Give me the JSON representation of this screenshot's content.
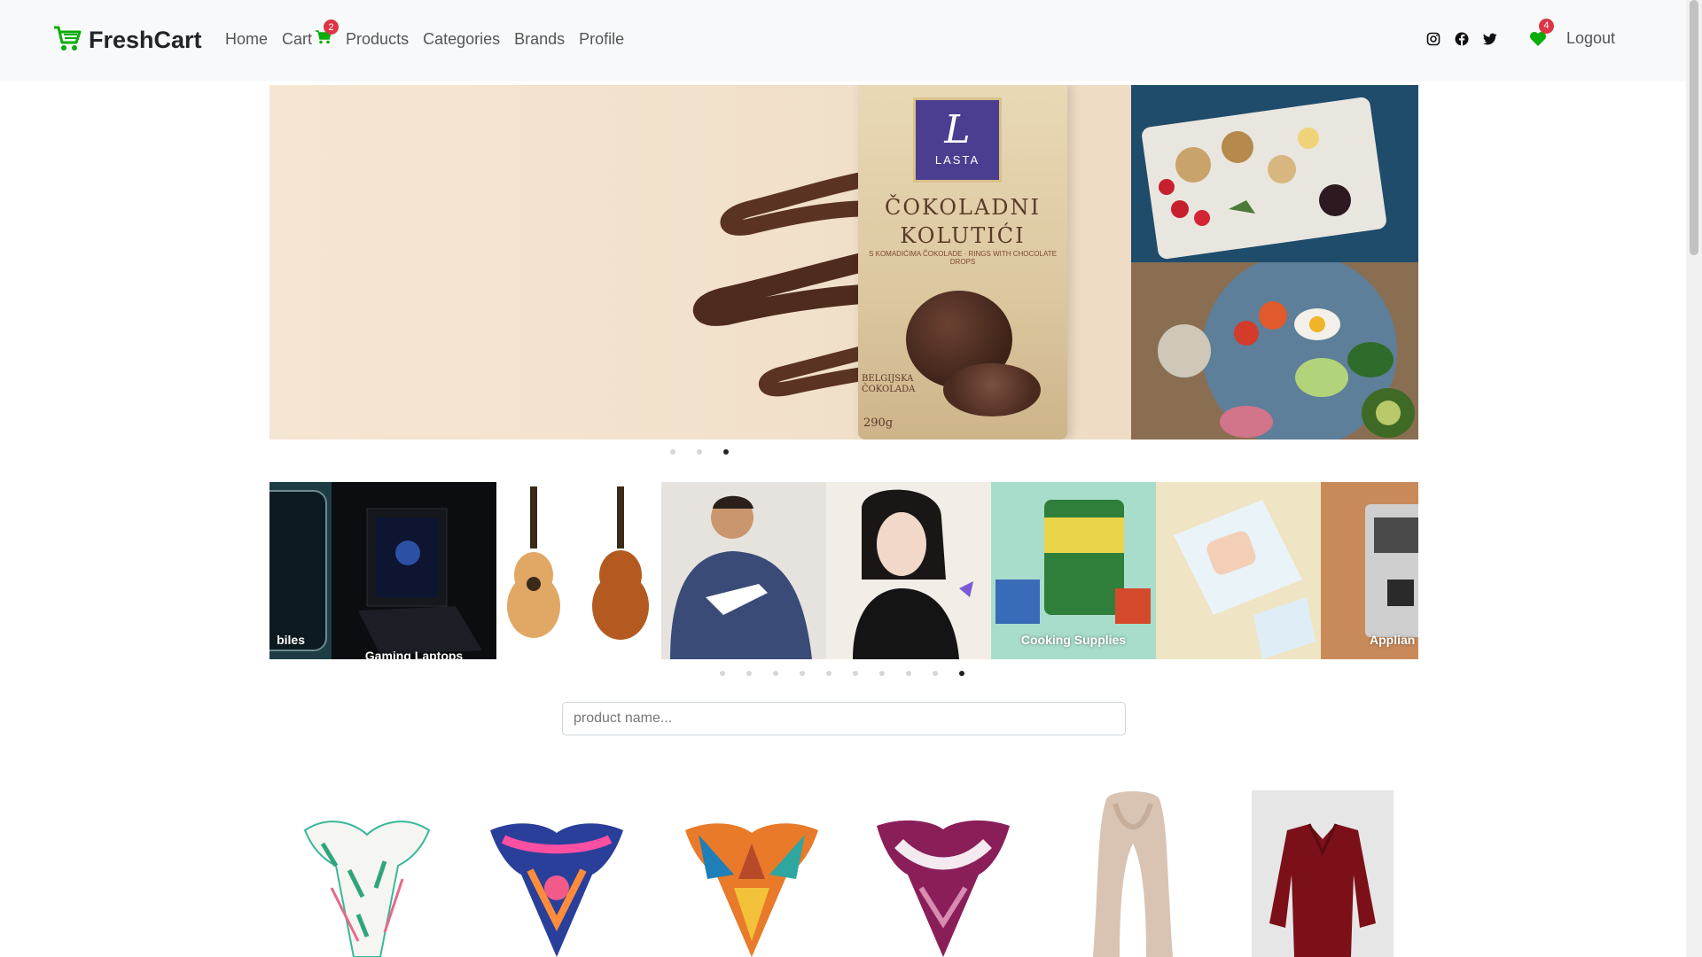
{
  "brand": {
    "name": "FreshCart",
    "accent": "#0aad0a"
  },
  "nav": {
    "home": "Home",
    "cart": "Cart",
    "cart_count": "2",
    "products": "Products",
    "categories": "Categories",
    "brands": "Brands",
    "profile": "Profile"
  },
  "nav_right": {
    "social_icons": [
      "instagram-icon",
      "facebook-icon",
      "twitter-icon"
    ],
    "wishlist_count": "4",
    "logout": "Logout"
  },
  "hero": {
    "bag_brand": "LASTA",
    "bag_title_line1": "ČOKOLADNI",
    "bag_title_line2": "KOLUTIĆI",
    "bag_subtitle": "S KOMADIĆIMA ČOKOLADE · RINGS WITH CHOCOLATE DROPS",
    "bag_origin": "BELGIJSKA ČOKOLADA",
    "bag_weight": "290g",
    "slide_count": 3,
    "active_slide": 3
  },
  "categories_slider": {
    "items": [
      {
        "label": "biles"
      },
      {
        "label": "Gaming Laptops"
      },
      {
        "label": ""
      },
      {
        "label": ""
      },
      {
        "label": ""
      },
      {
        "label": "Cooking Supplies"
      },
      {
        "label": ""
      },
      {
        "label": "Applian"
      }
    ],
    "dot_count": 10,
    "active_dot": 10
  },
  "search": {
    "placeholder": "product name..."
  },
  "colors": {
    "badge": "#dc3545",
    "navbar_bg": "#f8f9fa"
  }
}
